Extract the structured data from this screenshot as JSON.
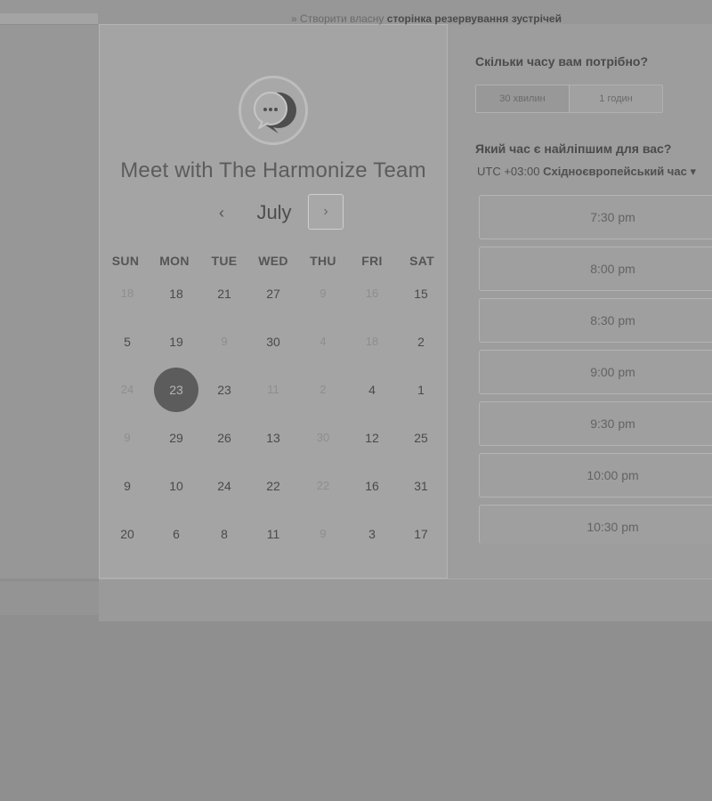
{
  "title": "Meet with The Harmonize Team",
  "calendar": {
    "month": "July",
    "prev_symbol": "‹",
    "next_symbol": "›",
    "weekdays": [
      "SUN",
      "MON",
      "TUE",
      "WED",
      "THU",
      "FRI",
      "SAT"
    ],
    "weeks": [
      [
        {
          "d": "18",
          "m": true
        },
        {
          "d": "18",
          "m": false
        },
        {
          "d": "21",
          "m": false
        },
        {
          "d": "27",
          "m": false
        },
        {
          "d": "9",
          "m": true
        },
        {
          "d": "16",
          "m": true
        },
        {
          "d": "15",
          "m": false
        }
      ],
      [
        {
          "d": "5",
          "m": false
        },
        {
          "d": "19",
          "m": false
        },
        {
          "d": "9",
          "m": true
        },
        {
          "d": "30",
          "m": false
        },
        {
          "d": "4",
          "m": true
        },
        {
          "d": "18",
          "m": true
        },
        {
          "d": "2",
          "m": false
        }
      ],
      [
        {
          "d": "24",
          "m": true
        },
        {
          "d": "23",
          "m": false,
          "s": true
        },
        {
          "d": "23",
          "m": false
        },
        {
          "d": "11",
          "m": true
        },
        {
          "d": "2",
          "m": true
        },
        {
          "d": "4",
          "m": false
        },
        {
          "d": "1",
          "m": false
        }
      ],
      [
        {
          "d": "9",
          "m": true
        },
        {
          "d": "29",
          "m": false
        },
        {
          "d": "26",
          "m": false
        },
        {
          "d": "13",
          "m": false
        },
        {
          "d": "30",
          "m": true
        },
        {
          "d": "12",
          "m": false
        },
        {
          "d": "25",
          "m": false
        }
      ],
      [
        {
          "d": "9",
          "m": false
        },
        {
          "d": "10",
          "m": false
        },
        {
          "d": "24",
          "m": false
        },
        {
          "d": "22",
          "m": false
        },
        {
          "d": "22",
          "m": true
        },
        {
          "d": "16",
          "m": false
        },
        {
          "d": "31",
          "m": false
        }
      ],
      [
        {
          "d": "20",
          "m": false
        },
        {
          "d": "6",
          "m": false
        },
        {
          "d": "8",
          "m": false
        },
        {
          "d": "11",
          "m": false
        },
        {
          "d": "9",
          "m": true
        },
        {
          "d": "3",
          "m": false
        },
        {
          "d": "17",
          "m": false
        }
      ]
    ]
  },
  "duration": {
    "question": "Скільки часу вам потрібно?",
    "options": [
      "30 хвилин",
      "1 годин"
    ],
    "selected_index": 0
  },
  "time": {
    "question": "Який час є найліпшим для вас?",
    "tz_offset": "UTC +03:00",
    "tz_name": "Східноєвропейський час",
    "tz_caret": "▾",
    "slots": [
      "7:30 pm",
      "8:00 pm",
      "8:30 pm",
      "9:00 pm",
      "9:30 pm",
      "10:00 pm",
      "10:30 pm"
    ]
  },
  "footer": {
    "icon_symbol": "»",
    "prefix": "Створити власну",
    "link": "сторінка резервування зустрічей"
  },
  "colors": {
    "selected_day": "#5c5c5c",
    "panel": "#a4a4a4",
    "background": "#8f8f8f"
  }
}
